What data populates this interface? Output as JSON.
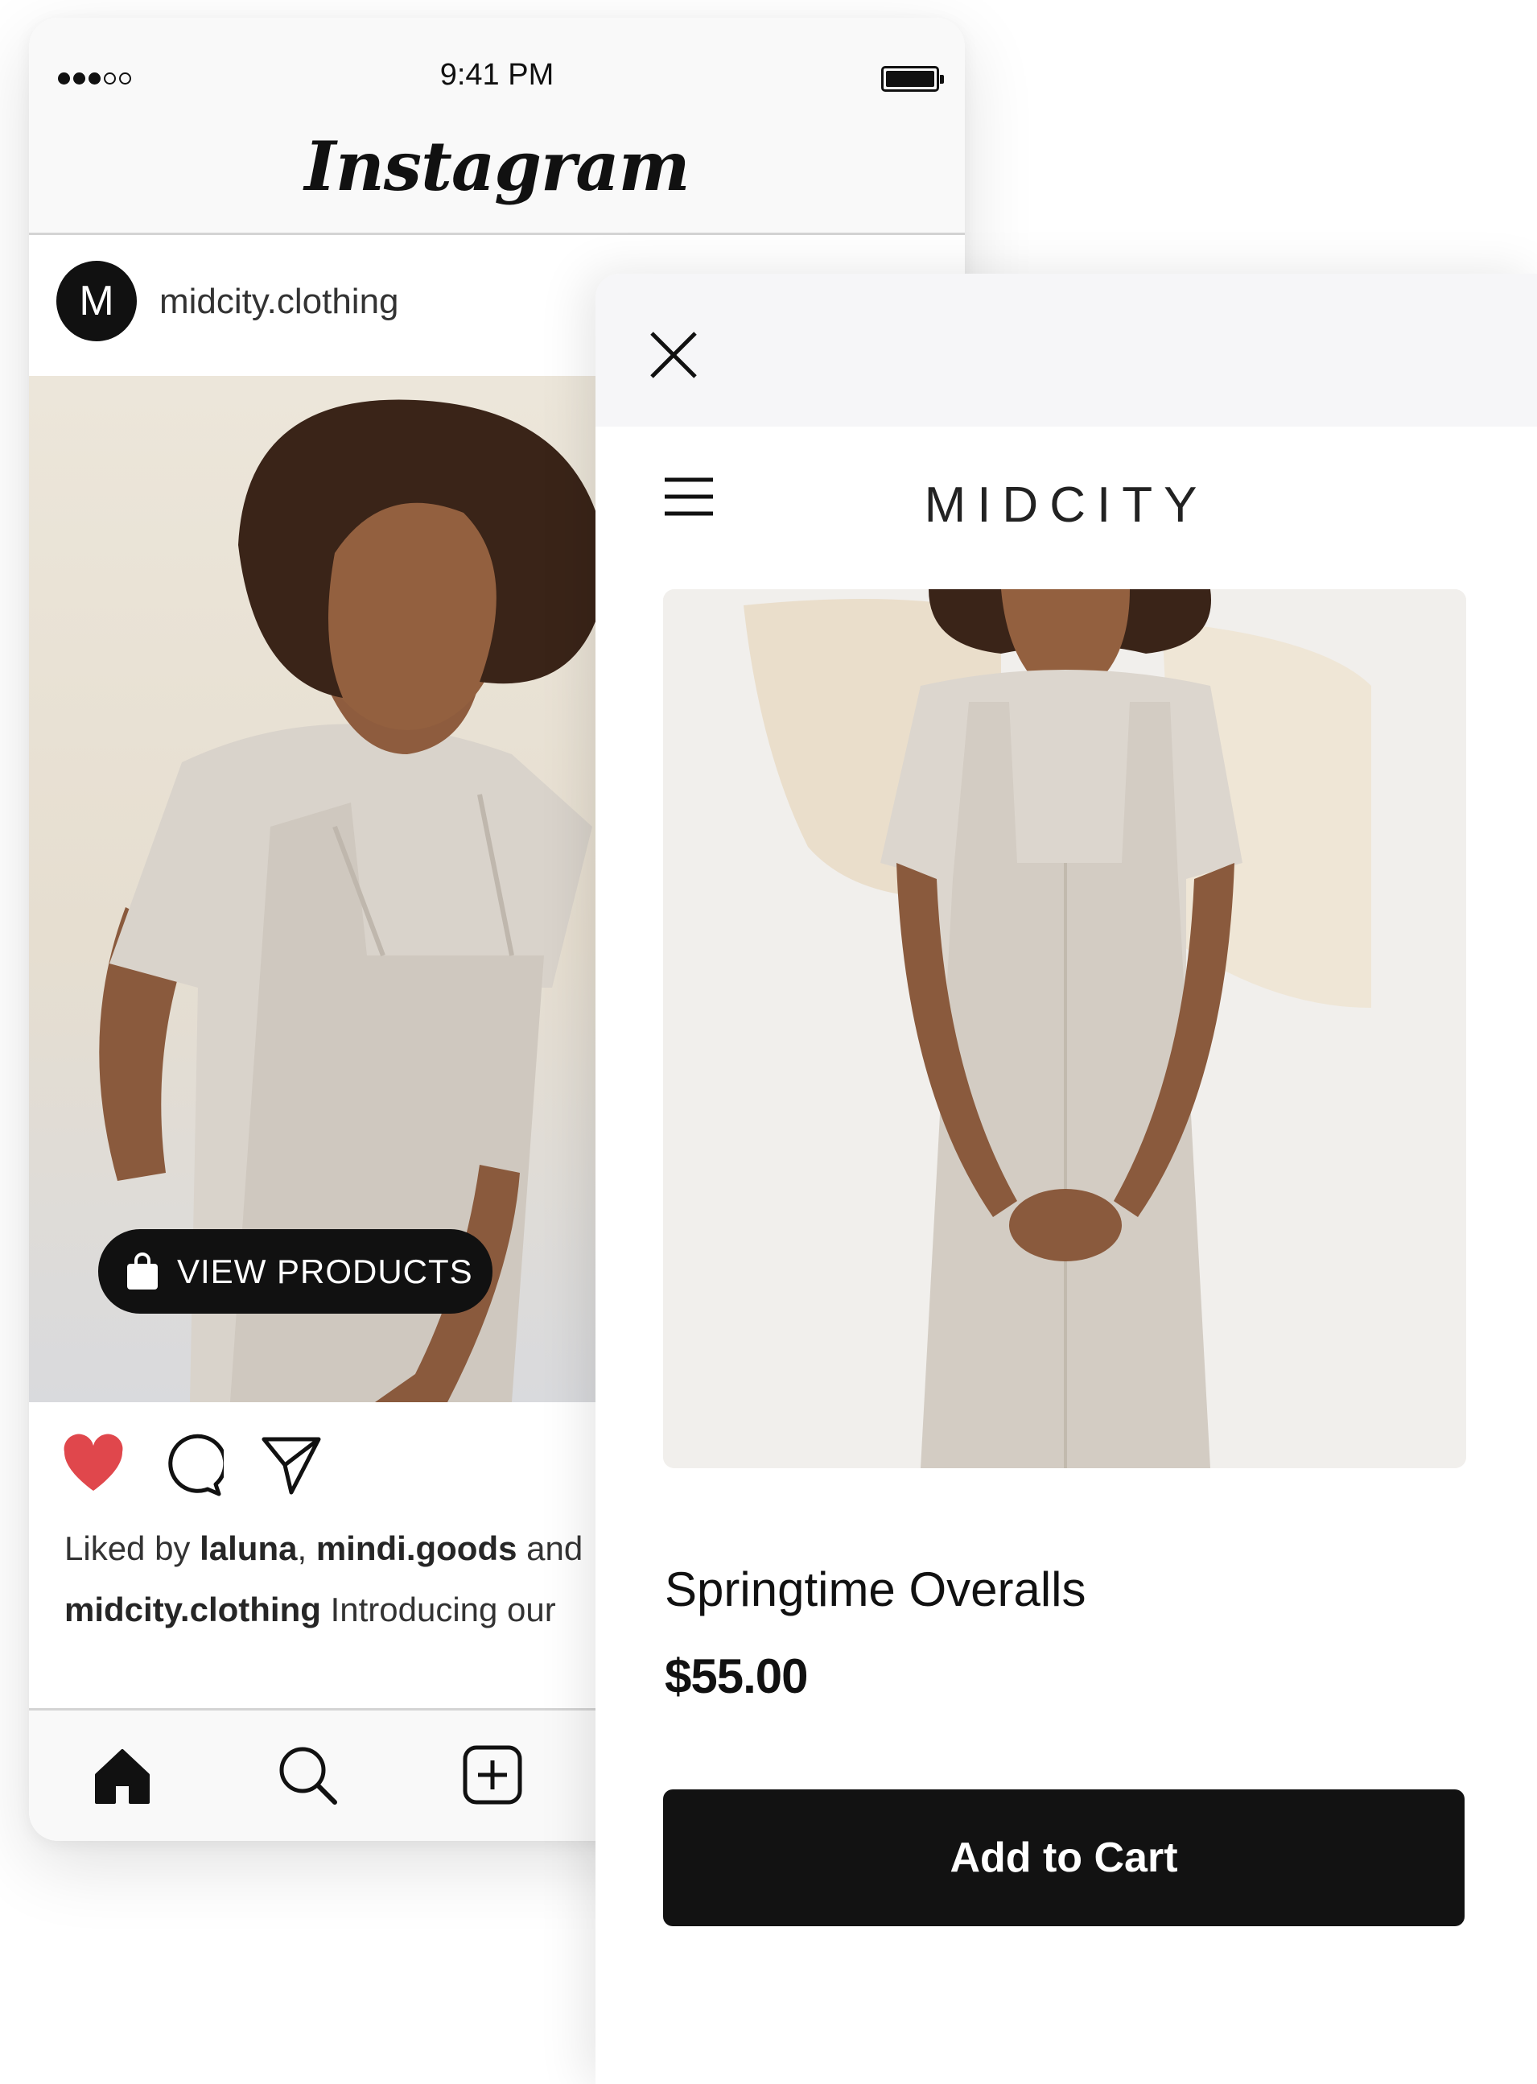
{
  "status_bar": {
    "time": "9:41 PM"
  },
  "instagram": {
    "logo": "Instagram",
    "post": {
      "avatar_initial": "M",
      "username": "midcity.clothing",
      "view_products_label": "VIEW PRODUCTS",
      "liked_prefix": "Liked by ",
      "liked_user_1": "laluna",
      "liked_sep": ", ",
      "liked_user_2": "mindi.goods",
      "liked_suffix": " and",
      "caption_user": "midcity.clothing",
      "caption_text": " Introducing our"
    },
    "icons": {
      "like": "heart-icon",
      "comment": "comment-icon",
      "share": "send-icon",
      "home": "home-icon",
      "search": "search-icon",
      "add": "add-post-icon"
    }
  },
  "shop": {
    "brand": "MIDCITY",
    "product_name": "Springtime Overalls",
    "price": "$55.00",
    "add_to_cart_label": "Add to Cart",
    "icons": {
      "close": "close-icon",
      "menu": "menu-icon"
    }
  },
  "colors": {
    "like_red": "#e0474c",
    "dark": "#121212",
    "header_bg": "#f9f9f9"
  }
}
